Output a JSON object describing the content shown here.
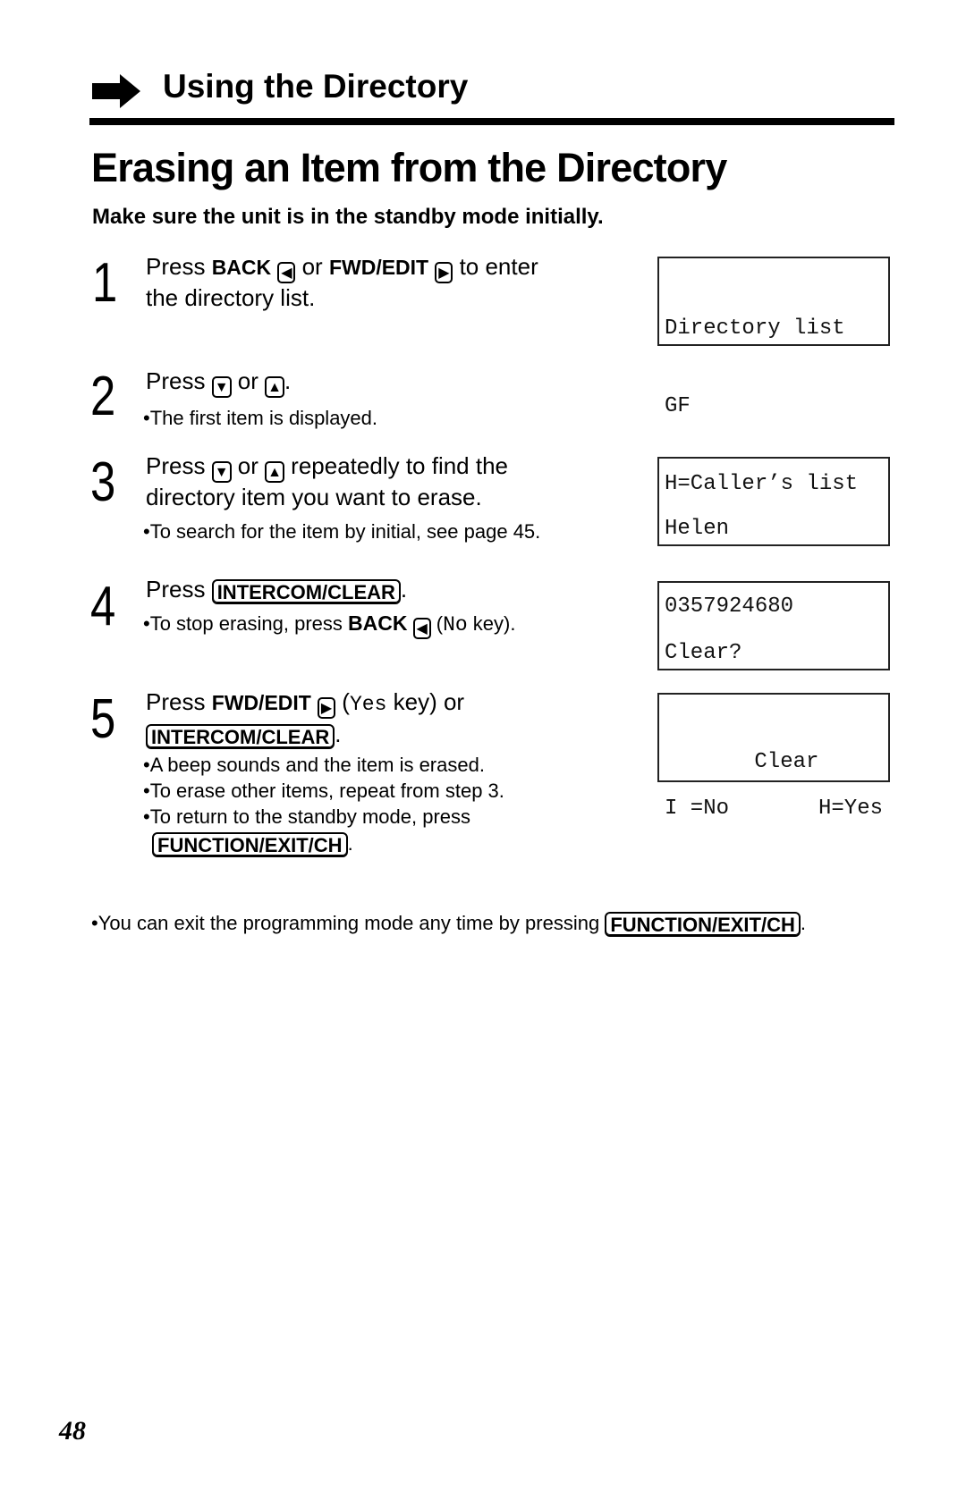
{
  "header": {
    "section_title": "Using the Directory",
    "page_title": "Erasing an Item from the Directory",
    "subtitle": "Make sure the unit is in the standby mode initially."
  },
  "icons": {
    "back": "◀",
    "fwd": "▶",
    "down": "▼",
    "up": "▲"
  },
  "steps": [
    {
      "number": "1",
      "text_press": "Press ",
      "back_label": "BACK",
      "or": " or ",
      "fwd_label": "FWD/EDIT",
      "text_end": " to enter",
      "line2": "the directory list."
    },
    {
      "number": "2",
      "text_press": "Press ",
      "or": " or ",
      "period": ".",
      "note": "•The first item is displayed."
    },
    {
      "number": "3",
      "text_press": "Press ",
      "or": " or ",
      "text_end": " repeatedly to find the",
      "line2": "directory item you want to erase.",
      "note": "•To search for the item by initial, see page 45."
    },
    {
      "number": "4",
      "text_press": "Press ",
      "key_label": "INTERCOM/CLEAR",
      "period": ".",
      "note_start": "•To stop erasing, press ",
      "back_label": "BACK",
      "paren_open": " (",
      "no_label": "No",
      "note_end": " key)."
    },
    {
      "number": "5",
      "text_press": "Press ",
      "fwd_label": "FWD/EDIT",
      "paren_open": " (",
      "yes_label": "Yes",
      "text_end": " key) or",
      "key_label": "INTERCOM/CLEAR",
      "period": ".",
      "notes": [
        "•A beep sounds and the item is erased.",
        "•To erase other items, repeat from step 3.",
        "•To return to the standby mode, press"
      ],
      "exit_key_label": "FUNCTION/EXIT/CH",
      "exit_period": "."
    }
  ],
  "displays": [
    {
      "lines": [
        "Directory list",
        "GF",
        "H=Caller’s list"
      ]
    },
    {
      "lines": [
        "Helen",
        "0357924680"
      ]
    },
    {
      "line1": "Clear?",
      "left": "I =No",
      "right": "H=Yes"
    },
    {
      "center": "Clear"
    }
  ],
  "footer": {
    "note": "•You can exit the programming mode any time by pressing ",
    "key_label": "FUNCTION/EXIT/CH",
    "period": "."
  },
  "page_number": "48"
}
